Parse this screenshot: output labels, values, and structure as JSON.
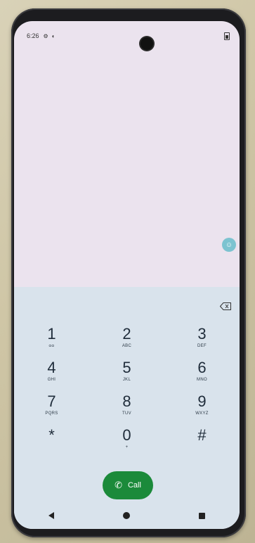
{
  "status_bar": {
    "time": "6:26",
    "icons": [
      "settings-icon",
      "notification-icon"
    ],
    "battery_icon": "battery-icon"
  },
  "dialpad": {
    "keys": [
      {
        "digit": "1",
        "letters": "ᴑᴑ"
      },
      {
        "digit": "2",
        "letters": "ABC"
      },
      {
        "digit": "3",
        "letters": "DEF"
      },
      {
        "digit": "4",
        "letters": "GHI"
      },
      {
        "digit": "5",
        "letters": "JKL"
      },
      {
        "digit": "6",
        "letters": "MNO"
      },
      {
        "digit": "7",
        "letters": "PQRS"
      },
      {
        "digit": "8",
        "letters": "TUV"
      },
      {
        "digit": "9",
        "letters": "WXYZ"
      },
      {
        "digit": "*",
        "letters": ""
      },
      {
        "digit": "0",
        "letters": "+"
      },
      {
        "digit": "#",
        "letters": ""
      }
    ],
    "call_label": "Call",
    "backspace_icon": "backspace-icon"
  },
  "colors": {
    "call_button": "#1b8a3a",
    "dialpad_bg": "#d9e3ec",
    "screen_bg": "#ebe3ee"
  }
}
